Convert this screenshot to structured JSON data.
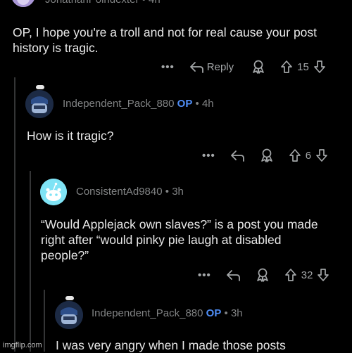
{
  "comments": [
    {
      "username": "JonathanPoindexter",
      "time": "4h",
      "body": "OP, I hope you're a troll and not for real cause your post history is tragic.",
      "reply_label": "Reply",
      "votes": "15"
    },
    {
      "username": "Independent_Pack_880",
      "op_badge": "OP",
      "time": "4h",
      "body": "How is it tragic?",
      "votes": "6"
    },
    {
      "username": "ConsistentAd9840",
      "time": "3h",
      "body": "“Would Applejack own slaves?” is a post you made right after “would pinky pie laugh at disabled people?”",
      "votes": "32"
    },
    {
      "username": "Independent_Pack_880",
      "op_badge": "OP",
      "time": "3h",
      "body": "I was very angry when I made those posts"
    }
  ],
  "more_label": "•••",
  "separator": "•",
  "icons": {
    "reply": "reply-arrow-icon",
    "award": "award-icon",
    "upvote": "upvote-arrow-icon",
    "downvote": "downvote-arrow-icon"
  },
  "watermark": "imgflip.com",
  "colors": {
    "background": "#000000",
    "text": "#e8e8e8",
    "meta": "#818384",
    "op": "#4f8ef7",
    "thread_line": "#343536"
  }
}
